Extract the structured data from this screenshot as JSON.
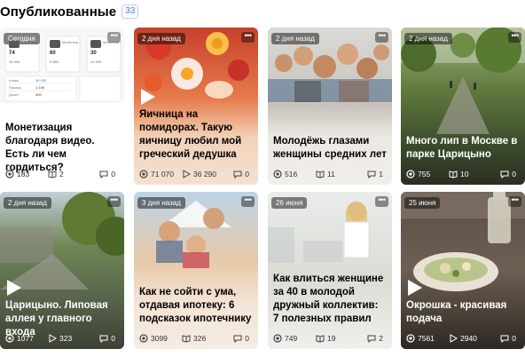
{
  "header": {
    "title": "Опубликованные",
    "count": "33"
  },
  "cards": [
    {
      "date": "Сегодня",
      "title": "Монетизация благодаря видео. Есть ли чем гордиться?",
      "views": "183",
      "reads": "2",
      "comments": "0",
      "has_play": false,
      "read_icon": "book-icon"
    },
    {
      "date": "2 дня назад",
      "title": "Яичница на помидорах. Такую яичницу любил мой греческий дедушка",
      "views": "71 070",
      "reads": "36 290",
      "comments": "0",
      "has_play": true,
      "read_icon": "play-small-icon"
    },
    {
      "date": "2 дня назад",
      "title": "Молодёжь глазами женщины средних лет",
      "views": "516",
      "reads": "11",
      "comments": "1",
      "has_play": false,
      "read_icon": "book-icon"
    },
    {
      "date": "2 дня назад",
      "title": "Много лип в Москве в парке Царицыно",
      "views": "755",
      "reads": "10",
      "comments": "0",
      "has_play": false,
      "read_icon": "book-icon"
    },
    {
      "date": "2 дня назад",
      "title": "Царицыно. Липовая аллея у главного входа",
      "views": "1077",
      "reads": "323",
      "comments": "0",
      "has_play": true,
      "read_icon": "play-small-icon"
    },
    {
      "date": "3 дня назад",
      "title": "Как не сойти с ума, отдавая ипотеку: 6 подсказок ипотечнику",
      "views": "3099",
      "reads": "326",
      "comments": "0",
      "has_play": false,
      "read_icon": "book-icon"
    },
    {
      "date": "26 июня",
      "title": "Как влиться женщине за 40 в молодой дружный коллектив: 7 полезных правил",
      "views": "749",
      "reads": "19",
      "comments": "2",
      "has_play": false,
      "read_icon": "book-icon"
    },
    {
      "date": "25 июня",
      "title": "Окрошка - красивая подача",
      "views": "7561",
      "reads": "2940",
      "comments": "0",
      "has_play": true,
      "read_icon": "play-small-icon"
    }
  ],
  "thumb1": {
    "cols": [
      {
        "label": "Монетиза...",
        "value": "74",
        "sub": "15 400"
      },
      {
        "label": "Монетиза...",
        "value": "60",
        "sub": "9 480"
      },
      {
        "label": "Монетиза...",
        "value": "30",
        "sub": "10 300"
      }
    ],
    "rows": [
      {
        "k": "Клики",
        "v": "38 085"
      },
      {
        "k": "Показы",
        "v": "1 190"
      },
      {
        "k": "Дочит.",
        "v": "420"
      }
    ]
  },
  "colors": {
    "accent": "#3f7cff"
  }
}
